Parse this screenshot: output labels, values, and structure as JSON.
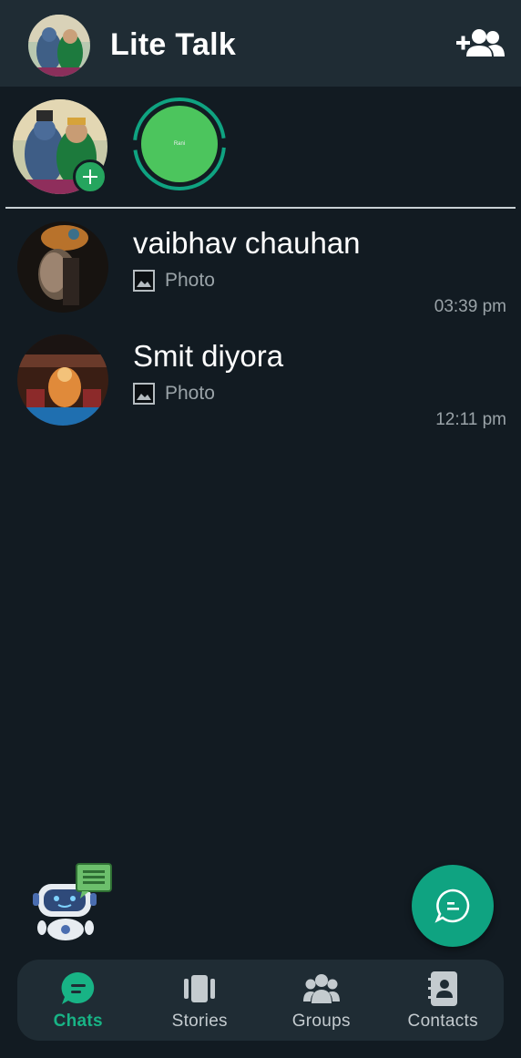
{
  "app": {
    "title": "Lite Talk"
  },
  "header": {
    "add_user_icon": "add-user-icon"
  },
  "stories": {
    "my_story_add_icon": "plus-icon",
    "items": [
      {
        "label": "Rani"
      }
    ]
  },
  "chats": [
    {
      "name": "vaibhav chauhan",
      "preview": "Photo",
      "preview_icon": "image-icon",
      "time": "03:39 pm"
    },
    {
      "name": "Smit diyora",
      "preview": "Photo",
      "preview_icon": "image-icon",
      "time": "12:11 pm"
    }
  ],
  "fab": {
    "icon": "new-chat-icon"
  },
  "bot": {
    "icon": "chatbot-icon"
  },
  "bottom_nav": [
    {
      "label": "Chats",
      "icon": "chats-icon",
      "active": true
    },
    {
      "label": "Stories",
      "icon": "stories-icon",
      "active": false
    },
    {
      "label": "Groups",
      "icon": "groups-icon",
      "active": false
    },
    {
      "label": "Contacts",
      "icon": "contacts-icon",
      "active": false
    }
  ],
  "colors": {
    "background": "#121b22",
    "surface": "#1f2c34",
    "accent": "#0fa381",
    "active_tab": "#18b385",
    "story_fill": "#4cc55d"
  }
}
